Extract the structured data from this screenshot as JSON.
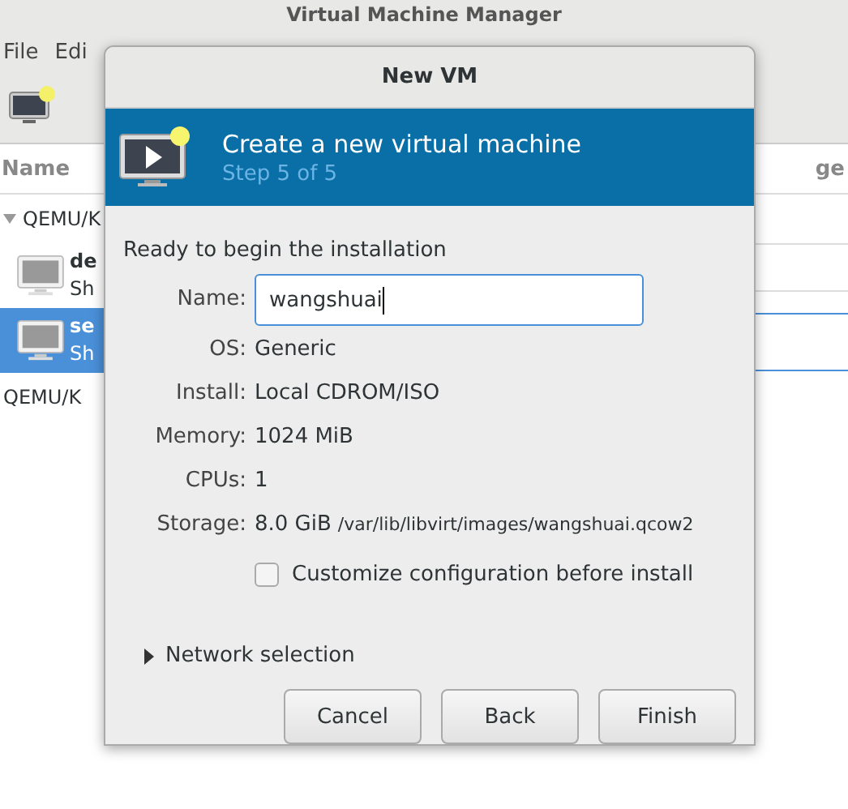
{
  "main_window": {
    "title": "Virtual Machine Manager",
    "menu": [
      "File",
      "Edi"
    ],
    "column_header": "Name",
    "column_header_2": "ge",
    "tree": [
      {
        "label": "QEMU/K",
        "expanded": true,
        "children": [
          {
            "name": "de",
            "status": "Sh",
            "selected": false
          },
          {
            "name": "se",
            "status": "Sh",
            "selected": true
          }
        ]
      },
      {
        "label": "QEMU/K"
      }
    ]
  },
  "dialog": {
    "title": "New VM",
    "banner_title": "Create a new virtual machine",
    "banner_step": "Step 5 of 5",
    "heading": "Ready to begin the installation",
    "name_label": "Name:",
    "name_value": "wangshuai",
    "details": [
      {
        "label": "OS:",
        "value": "Generic"
      },
      {
        "label": "Install:",
        "value": "Local CDROM/ISO"
      },
      {
        "label": "Memory:",
        "value": "1024 MiB"
      },
      {
        "label": "CPUs:",
        "value": "1"
      },
      {
        "label": "Storage:",
        "value": "8.0 GiB",
        "path": "/var/lib/libvirt/images/wangshuai.qcow2"
      }
    ],
    "customize": {
      "label": "Customize configuration before install",
      "checked": false
    },
    "network": {
      "label": "Network selection",
      "expanded": false
    },
    "buttons": [
      "Cancel",
      "Back",
      "Finish"
    ]
  }
}
